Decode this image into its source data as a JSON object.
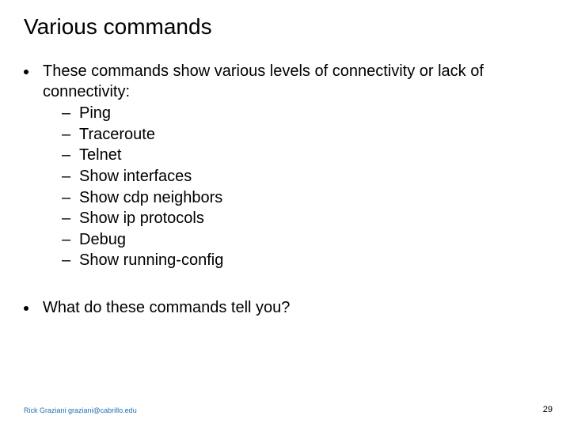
{
  "title": "Various commands",
  "bullet1": {
    "lead": "These commands show various levels of connectivity or lack of connectivity:",
    "items": [
      "Ping",
      "Traceroute",
      "Telnet",
      "Show interfaces",
      "Show cdp neighbors",
      "Show ip protocols",
      "Debug",
      "Show running-config"
    ]
  },
  "bullet2": "What do these commands tell you?",
  "footer": {
    "author": "Rick Graziani  graziani@cabrillo.edu",
    "page": "29"
  },
  "dash": "–"
}
